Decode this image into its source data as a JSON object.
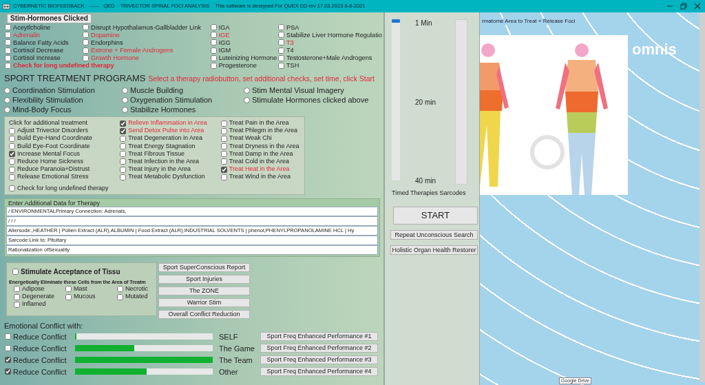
{
  "title_bar": {
    "title": "CYBERNETIC BIOFEEDBACK   ------   QED    TRIVECTOR SPINAL FOCI ANALYSIS    This software is designed For QUEX ED rev 17.03.2023 8-8-2021"
  },
  "hormones": {
    "heading": "Stim-Hormones Clicked",
    "columns": [
      [
        {
          "label": "Aceytlcholine",
          "checked": false,
          "highlighted": false
        },
        {
          "label": "Adrenalin",
          "checked": false,
          "highlighted": true
        },
        {
          "label": "Balance Fatty Acids",
          "checked": false,
          "highlighted": false
        },
        {
          "label": "Cortisol Decrease",
          "checked": false,
          "highlighted": false
        },
        {
          "label": "Cortisol Increase",
          "checked": false,
          "highlighted": false
        }
      ],
      [
        {
          "label": "Disrupt Hypothalamus-Gallbladder Link",
          "checked": false,
          "highlighted": false
        },
        {
          "label": "Dopamine",
          "checked": false,
          "highlighted": true
        },
        {
          "label": "Endorphins",
          "checked": false,
          "highlighted": false
        },
        {
          "label": "Estrone + Female Androgens",
          "checked": false,
          "highlighted": true
        },
        {
          "label": "Growth Hormone",
          "checked": false,
          "highlighted": true
        }
      ],
      [
        {
          "label": "IGA",
          "checked": false,
          "highlighted": false
        },
        {
          "label": "IGE",
          "checked": false,
          "highlighted": true
        },
        {
          "label": "IGG",
          "checked": false,
          "highlighted": false
        },
        {
          "label": "IGM",
          "checked": false,
          "highlighted": false
        },
        {
          "label": "Luteinizing Hormone",
          "checked": false,
          "highlighted": false
        },
        {
          "label": "Progesterone",
          "checked": false,
          "highlighted": false
        }
      ],
      [
        {
          "label": "PSA",
          "checked": false,
          "highlighted": false
        },
        {
          "label": "Stabilize Liver Hormone Regulatio",
          "checked": false,
          "highlighted": false
        },
        {
          "label": "T3",
          "checked": false,
          "highlighted": true
        },
        {
          "label": "T4",
          "checked": false,
          "highlighted": false
        },
        {
          "label": "Testosterone+Male Androgens",
          "checked": false,
          "highlighted": false
        },
        {
          "label": "TSH",
          "checked": false,
          "highlighted": false
        }
      ]
    ],
    "long_therapy_check": {
      "label": "Check for long undefined therapy",
      "checked": false
    }
  },
  "programs": {
    "title": "SPORT TREATMENT PROGRAMS",
    "instruction": "Select a therapy radiobutton, set additional checks, set time, click Start",
    "options": [
      {
        "label": "Coordination Stimulation",
        "selected": false
      },
      {
        "label": "Muscle Building",
        "selected": false
      },
      {
        "label": "Stim Mental Visual Imagery",
        "selected": false
      },
      {
        "label": "Flexibility  Stimulation",
        "selected": false
      },
      {
        "label": "Oxygenation Stimulation",
        "selected": false
      },
      {
        "label": "Stimulate Hormones clicked above",
        "selected": false
      },
      {
        "label": "Mind-Body Focus",
        "selected": false
      },
      {
        "label": "Stabilize Hormones",
        "selected": false
      }
    ]
  },
  "additional_treatment": {
    "heading": "Click for additional treatment",
    "columns": [
      [
        {
          "label": "Adjust Trivector Disorders",
          "checked": false,
          "highlighted": false
        },
        {
          "label": "Build Eye-Hand Coordinate",
          "checked": false,
          "highlighted": false
        },
        {
          "label": "Build Eye-Foot Coordinate",
          "checked": false,
          "highlighted": false
        },
        {
          "label": "Increase Mental Focus",
          "checked": true,
          "highlighted": false
        },
        {
          "label": "Reduce Home Sickness",
          "checked": false,
          "highlighted": false
        },
        {
          "label": "Reduce Paranoia+Distrust",
          "checked": false,
          "highlighted": false
        },
        {
          "label": "Release Emotional Stress",
          "checked": false,
          "highlighted": false
        }
      ],
      [
        {
          "label": "Relieve Inflammation in Area",
          "checked": true,
          "highlighted": true
        },
        {
          "label": "Send Detox Pulse into Area",
          "checked": true,
          "highlighted": true
        },
        {
          "label": "Treat Degeneration in Area",
          "checked": false,
          "highlighted": false
        },
        {
          "label": "Treat Energy Stagnation",
          "checked": false,
          "highlighted": false
        },
        {
          "label": "Treat Fibrous Tissue",
          "checked": false,
          "highlighted": false
        },
        {
          "label": "Treat Infection in the Area",
          "checked": false,
          "highlighted": false
        },
        {
          "label": "Treat Injury in the Area",
          "checked": false,
          "highlighted": false
        },
        {
          "label": "Treat Metabolic Dysfunction",
          "checked": false,
          "highlighted": false
        }
      ],
      [
        {
          "label": "Treat Pain in the Area",
          "checked": false,
          "highlighted": false
        },
        {
          "label": "Treat  Phlegm in the Area",
          "checked": false,
          "highlighted": false
        },
        {
          "label": "Treat Weak Chi",
          "checked": false,
          "highlighted": false
        },
        {
          "label": "Treat Dryness in the Area",
          "checked": false,
          "highlighted": false
        },
        {
          "label": "Treat Damp in the Area",
          "checked": false,
          "highlighted": false
        },
        {
          "label": "Treat Cold in the Area",
          "checked": false,
          "highlighted": false
        },
        {
          "label": "Treat Heat in the Area",
          "checked": true,
          "highlighted": true
        },
        {
          "label": "Treat Wind in the Area",
          "checked": false,
          "highlighted": false
        }
      ]
    ],
    "long_therapy_check": {
      "label": "Check for long undefined therapy",
      "checked": false
    }
  },
  "therapy_data": {
    "label": "Enter Additional Data for Therapy",
    "lines": [
      " / ENVIRONMENTALPrimary Connection: Adrenals,",
      " /  /  /",
      "Allersode:,HEATHER | Pollen Extract (ALR),ALBUMIN | Food Extract (ALR),INDUSTRIAL SOLVENTS | phenol,PHENYLPROPANOLAMINE  HCL | Hy",
      "Sarcode:Link to: Pituitary",
      "Rationalization ofSexuality"
    ]
  },
  "tissue": {
    "stimulate": {
      "label": "Stimulate Acceptance of Tissu",
      "checked": false
    },
    "eliminate_heading": "Energetically Eliminate these Cells from the Area of Treatm",
    "cells": [
      {
        "label": "Adipose",
        "checked": false
      },
      {
        "label": "Mast",
        "checked": false
      },
      {
        "label": "Necrotic",
        "checked": false
      },
      {
        "label": "Degenerate",
        "checked": false
      },
      {
        "label": "Mucous",
        "checked": false
      },
      {
        "label": "Mutated",
        "checked": false
      },
      {
        "label": "Inflamed",
        "checked": false
      }
    ]
  },
  "report_buttons": [
    "Sport SuperConscious Report",
    "Sport Injuries",
    "The ZONE",
    "Warrior Stim",
    "Overall Conflict Reduction"
  ],
  "conflict": {
    "heading": "Emotional Conflict with:",
    "rows": [
      {
        "label": "Reduce Conflict",
        "checked": false,
        "level": 0.01,
        "target": "SELF",
        "button": "Sport Freq Enhanced Performance #1"
      },
      {
        "label": "Reduce Conflict",
        "checked": false,
        "level": 0.43,
        "target": "The Game",
        "button": "Sport Freq Enhanced Performance #2"
      },
      {
        "label": "Reduce Conflict",
        "checked": true,
        "level": 1,
        "target": "The Team",
        "button": "Sport Freq Enhanced Performance #3"
      },
      {
        "label": "Reduce Conflict",
        "checked": true,
        "level": 0.52,
        "target": "Other",
        "button": "Sport Freq Enhanced Performance #4"
      }
    ]
  },
  "timer": {
    "slider": {
      "level": 0,
      "ticks": [
        "1 Min",
        "20 min",
        "40 min"
      ]
    },
    "caption": "Timed Therapies Sarcodes",
    "start": "START",
    "buttons": [
      "Repeat Unconscious Search",
      "Holistic Organ Health Restorer"
    ]
  },
  "viewer": {
    "title": "rmatome Area to Treat + Release Foci"
  },
  "desktop": {
    "logo_text": "omnis",
    "tooltip": "Google Drive"
  }
}
